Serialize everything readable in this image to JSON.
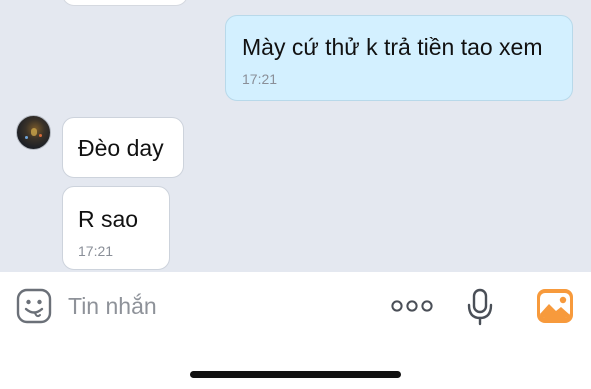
{
  "messages": [
    {
      "direction": "outgoing",
      "text": "Mày cứ thử k trả tiền tao xem",
      "time": "17:21"
    },
    {
      "direction": "incoming",
      "text": "Đèo day",
      "time": ""
    },
    {
      "direction": "incoming",
      "text": "R sao",
      "time": "17:21"
    }
  ],
  "composer": {
    "placeholder": "Tin nhắn"
  },
  "icons": {
    "emoji": "sticker-face-icon",
    "more": "more-dots-icon",
    "mic": "microphone-icon",
    "gallery": "image-gallery-icon"
  },
  "colors": {
    "chat_background": "#e4e8f0",
    "outgoing_bubble": "#d3f0ff",
    "incoming_bubble": "#ffffff",
    "gallery_icon": "#f79a3c"
  }
}
